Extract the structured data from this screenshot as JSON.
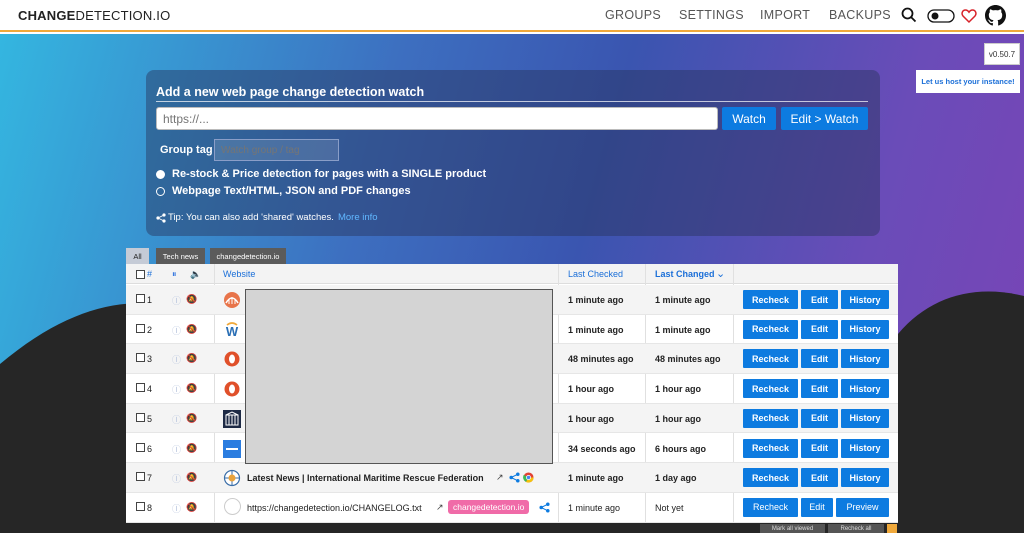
{
  "brand": {
    "bold": "CHANGE",
    "rest": "DETECTION.IO"
  },
  "nav": {
    "groups": "GROUPS",
    "settings": "SETTINGS",
    "import": "IMPORT",
    "backups": "BACKUPS"
  },
  "version": "v0.50.7",
  "host_link": "Let us host your instance!",
  "add_watch": {
    "title": "Add a new web page change detection watch",
    "url_placeholder": "https://...",
    "watch_button": "Watch",
    "edit_watch_button": "Edit > Watch",
    "group_tag_label": "Group tag",
    "group_tag_placeholder": "Watch group / tag",
    "option_restock": "Re-stock & Price detection for pages with a SINGLE product",
    "option_text": "Webpage Text/HTML, JSON and PDF changes",
    "tip_text": "Tip: You can also add 'shared' watches.",
    "tip_link": "More info"
  },
  "tabs": [
    "All",
    "Tech news",
    "changedetection.io"
  ],
  "table": {
    "headers": {
      "num": "#",
      "website": "Website",
      "last_checked": "Last Checked",
      "last_changed": "Last Changed"
    },
    "rows": [
      {
        "num": "1",
        "title": "",
        "last_checked": "1 minute ago",
        "last_changed": "1 minute ago",
        "actions": [
          "Recheck",
          "Edit",
          "History"
        ]
      },
      {
        "num": "2",
        "title": "",
        "last_checked": "1 minute ago",
        "last_changed": "1 minute ago",
        "actions": [
          "Recheck",
          "Edit",
          "History"
        ]
      },
      {
        "num": "3",
        "title": "",
        "last_checked": "48 minutes ago",
        "last_changed": "48 minutes ago",
        "actions": [
          "Recheck",
          "Edit",
          "History"
        ]
      },
      {
        "num": "4",
        "title": "",
        "last_checked": "1 hour ago",
        "last_changed": "1 hour ago",
        "actions": [
          "Recheck",
          "Edit",
          "History"
        ]
      },
      {
        "num": "5",
        "title": "",
        "last_checked": "1 hour ago",
        "last_changed": "1 hour ago",
        "actions": [
          "Recheck",
          "Edit",
          "History"
        ]
      },
      {
        "num": "6",
        "title": "",
        "last_checked": "34 seconds ago",
        "last_changed": "6 hours ago",
        "actions": [
          "Recheck",
          "Edit",
          "History"
        ]
      },
      {
        "num": "7",
        "title": "Latest News | International Maritime Rescue Federation",
        "last_checked": "1 minute ago",
        "last_changed": "1 day ago",
        "actions": [
          "Recheck",
          "Edit",
          "History"
        ]
      },
      {
        "num": "8",
        "title": "https://changedetection.io/CHANGELOG.txt",
        "tag": "changedetection.io",
        "last_checked": "1 minute ago",
        "last_changed": "Not yet",
        "actions": [
          "Recheck",
          "Edit",
          "Preview"
        ]
      }
    ]
  },
  "bottom": {
    "mark_viewed": "Mark all viewed",
    "recheck_all": "Recheck all"
  },
  "colors": {
    "accent": "#0d7be0",
    "brand_underline": "#f0a93b",
    "tag_pink": "#f06ba8"
  }
}
